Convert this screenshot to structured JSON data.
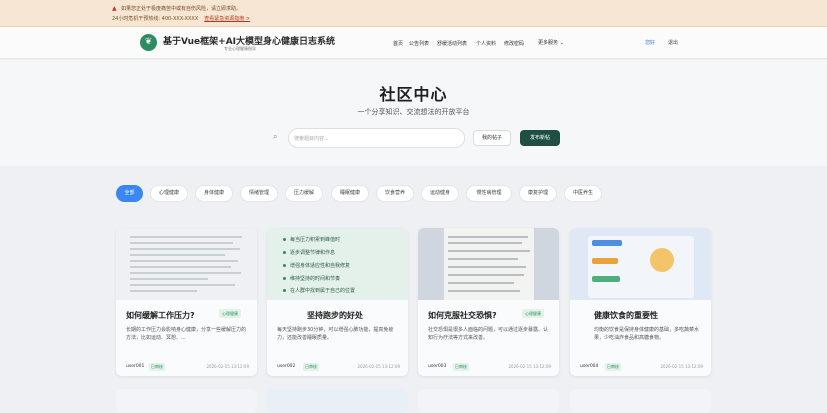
{
  "banner": {
    "line1": "如果您正处于极度痛苦中或有自伤风险，请立即求助。",
    "line2": "24小时危机干预热线: 400-XXX-XXXX",
    "link": "查看紧急资源指南 >"
  },
  "header": {
    "logo_icon": "leaf-logo-icon",
    "title": "基于Vue框架+AI大模型身心健康日志系统",
    "subtitle": "专业心理健康指导",
    "nav": [
      "首页",
      "公告列表",
      "舒缓活动列表",
      "个人资料",
      "修改密码"
    ],
    "more": "更多服务",
    "greeting": "您好",
    "logout": "退出"
  },
  "hero": {
    "title": "社区中心",
    "subtitle": "一个分享知识、交流想法的开放平台",
    "search_placeholder": "搜索题目内容...",
    "my_posts": "我的帖子",
    "publish": "发布新帖"
  },
  "categories": [
    "全部",
    "心理健康",
    "身体健康",
    "情绪管理",
    "压力缓解",
    "睡眠健康",
    "饮食营养",
    "运动健身",
    "慢性病管理",
    "康复护理",
    "中医养生"
  ],
  "active_category": "全部",
  "cards": [
    {
      "title": "如何缓解工作压力?",
      "tag": "心理健康",
      "excerpt": "长期的工作压力会影响身心健康，分享一些缓解压力的方法，比如运动、冥想、...",
      "user": "user001",
      "status": "已审核",
      "time": "2026-02-15 13:12:09"
    },
    {
      "title": "坚持跑步的好处",
      "tag": "心理健康",
      "excerpt": "每天坚持跑步30分钟，可以增强心肺功能，提高免疫力，还能改善睡眠质量。",
      "user": "user002",
      "status": "已审核",
      "time": "2026-02-15 13:12:09"
    },
    {
      "title": "如何克服社交恐惧?",
      "tag": "心理健康",
      "excerpt": "社交恐惧是很多人面临的问题，可以通过逐步暴露、认知行为疗法等方式来改善。",
      "user": "user003",
      "status": "已审核",
      "time": "2026-02-15 13:12:09"
    },
    {
      "title": "健康饮食的重要性",
      "tag": "",
      "excerpt": "均衡的饮食是保持身体健康的基础，多吃蔬菜水果，少吃油炸食品和高糖食物。",
      "user": "user004",
      "status": "已审核",
      "time": "2026-02-15 13:12:09"
    }
  ],
  "card2_list": [
    "每当压力积累到峰值时",
    "逐步调整节律和作息",
    "增强身体适应性和自我修复",
    "维持坚持的时间和节奏",
    "在人群中找到属于自己的位置"
  ],
  "colors": {
    "accent": "#3a86f2",
    "brand": "#2e8b62",
    "publish": "#1f4f42",
    "banner": "#f7e6d3"
  }
}
